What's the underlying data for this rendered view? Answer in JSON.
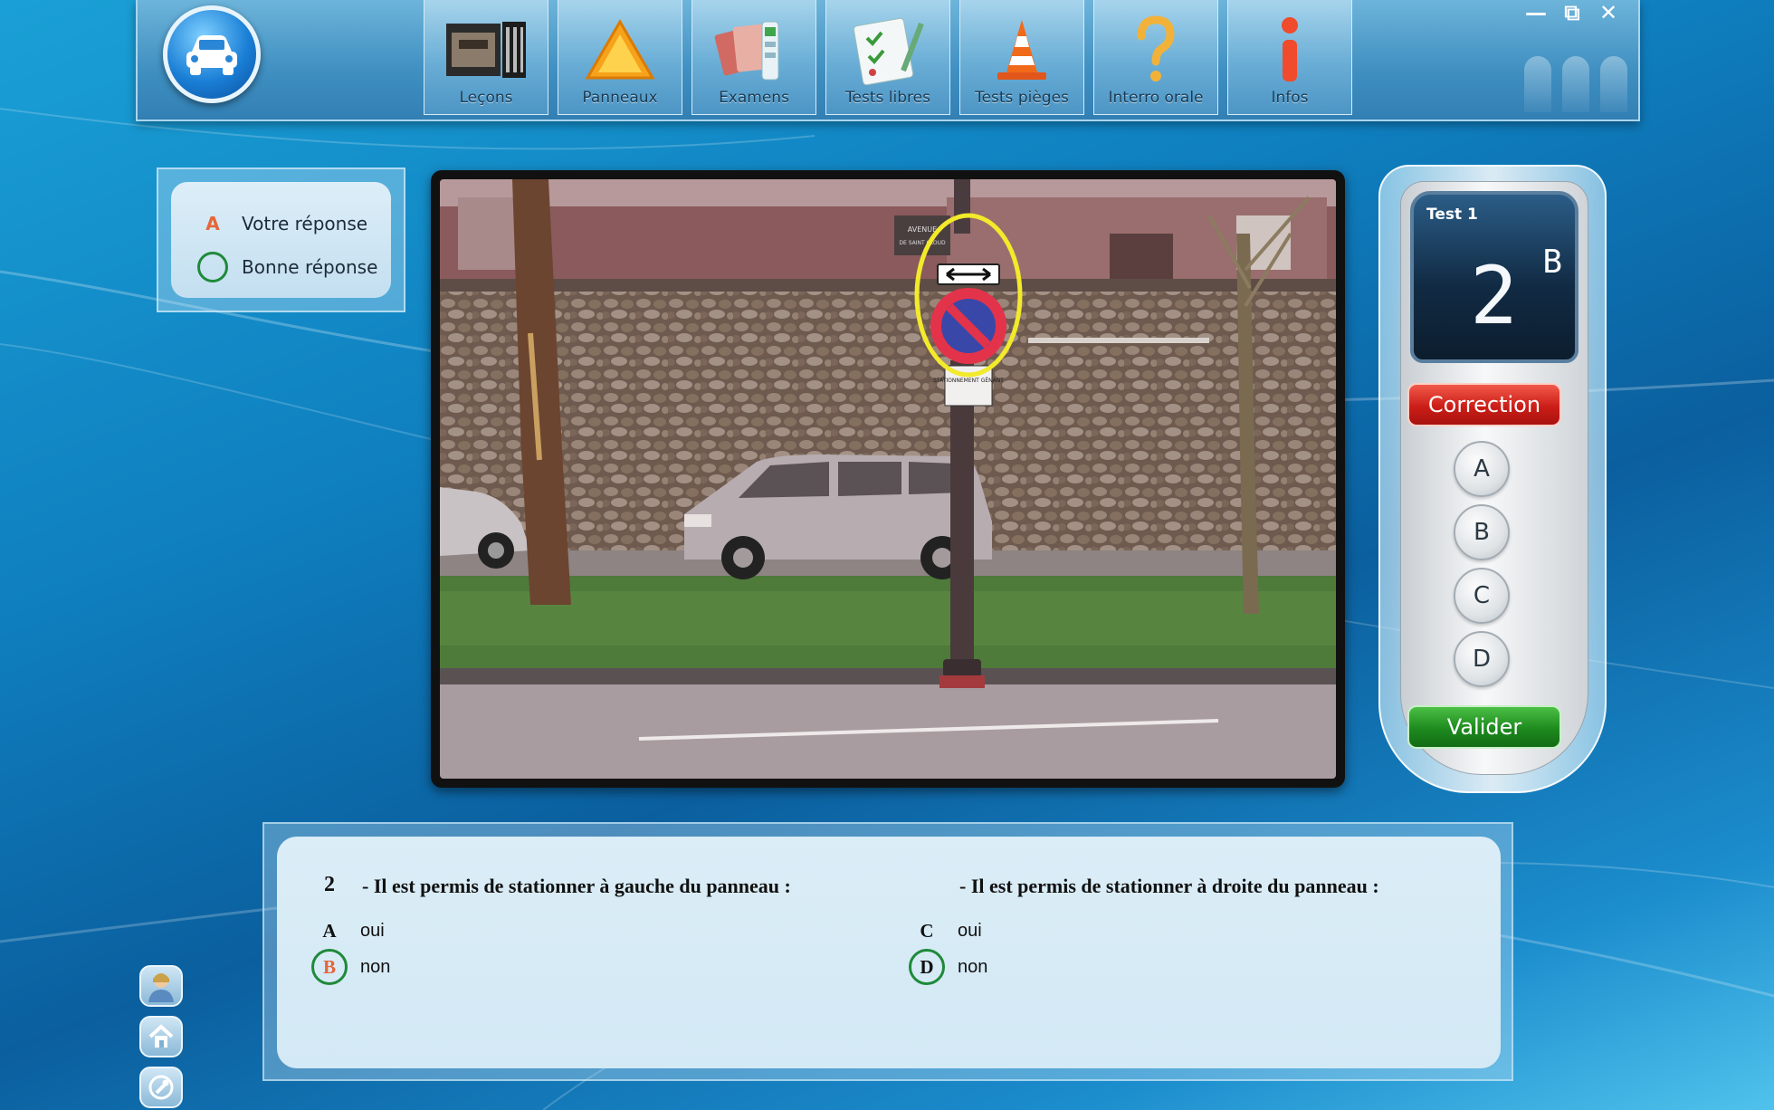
{
  "toolbar": {
    "app_logo_icon": "car-icon",
    "nav": [
      {
        "label": "Leçons",
        "icon": "filmstrip-icon"
      },
      {
        "label": "Panneaux",
        "icon": "warning-triangle-icon"
      },
      {
        "label": "Examens",
        "icon": "documents-icon"
      },
      {
        "label": "Tests libres",
        "icon": "checklist-icon"
      },
      {
        "label": "Tests pièges",
        "icon": "traffic-cone-icon"
      },
      {
        "label": "Interro orale",
        "icon": "question-mark-icon"
      },
      {
        "label": "Infos",
        "icon": "info-icon"
      }
    ],
    "window_controls": {
      "minimize": "—",
      "restore": "⧉",
      "close": "✕"
    }
  },
  "legend": {
    "user_answer": {
      "mark": "A",
      "label": "Votre réponse"
    },
    "correct_answer": {
      "label": "Bonne réponse"
    }
  },
  "photo": {
    "street_sign_line1": "AVENUE",
    "street_sign_line2": "DE SAINT CLOUD",
    "sign_plate": "STATIONNEMENT GÊNANT",
    "highlight_color": "#f2ea2a"
  },
  "remote": {
    "test_label": "Test 1",
    "question_number": "2",
    "selected_letter": "B",
    "correction_label": "Correction",
    "keys": [
      "A",
      "B",
      "C",
      "D"
    ],
    "validate_label": "Valider"
  },
  "question": {
    "number": "2",
    "left_text": "- Il est permis de stationner à gauche du panneau :",
    "right_text": "- Il est permis de stationner à droite du panneau :",
    "options": [
      {
        "letter": "A",
        "text": "oui"
      },
      {
        "letter": "B",
        "text": "non"
      },
      {
        "letter": "C",
        "text": "oui"
      },
      {
        "letter": "D",
        "text": "non"
      }
    ]
  },
  "side_icons": [
    "user-avatar-icon",
    "home-icon",
    "wrench-icon"
  ],
  "colors": {
    "correct": "#1f8a3a",
    "user_answer": "#e5663a",
    "correction_button": "#cc1e18",
    "validate_button": "#1d8a1e"
  }
}
